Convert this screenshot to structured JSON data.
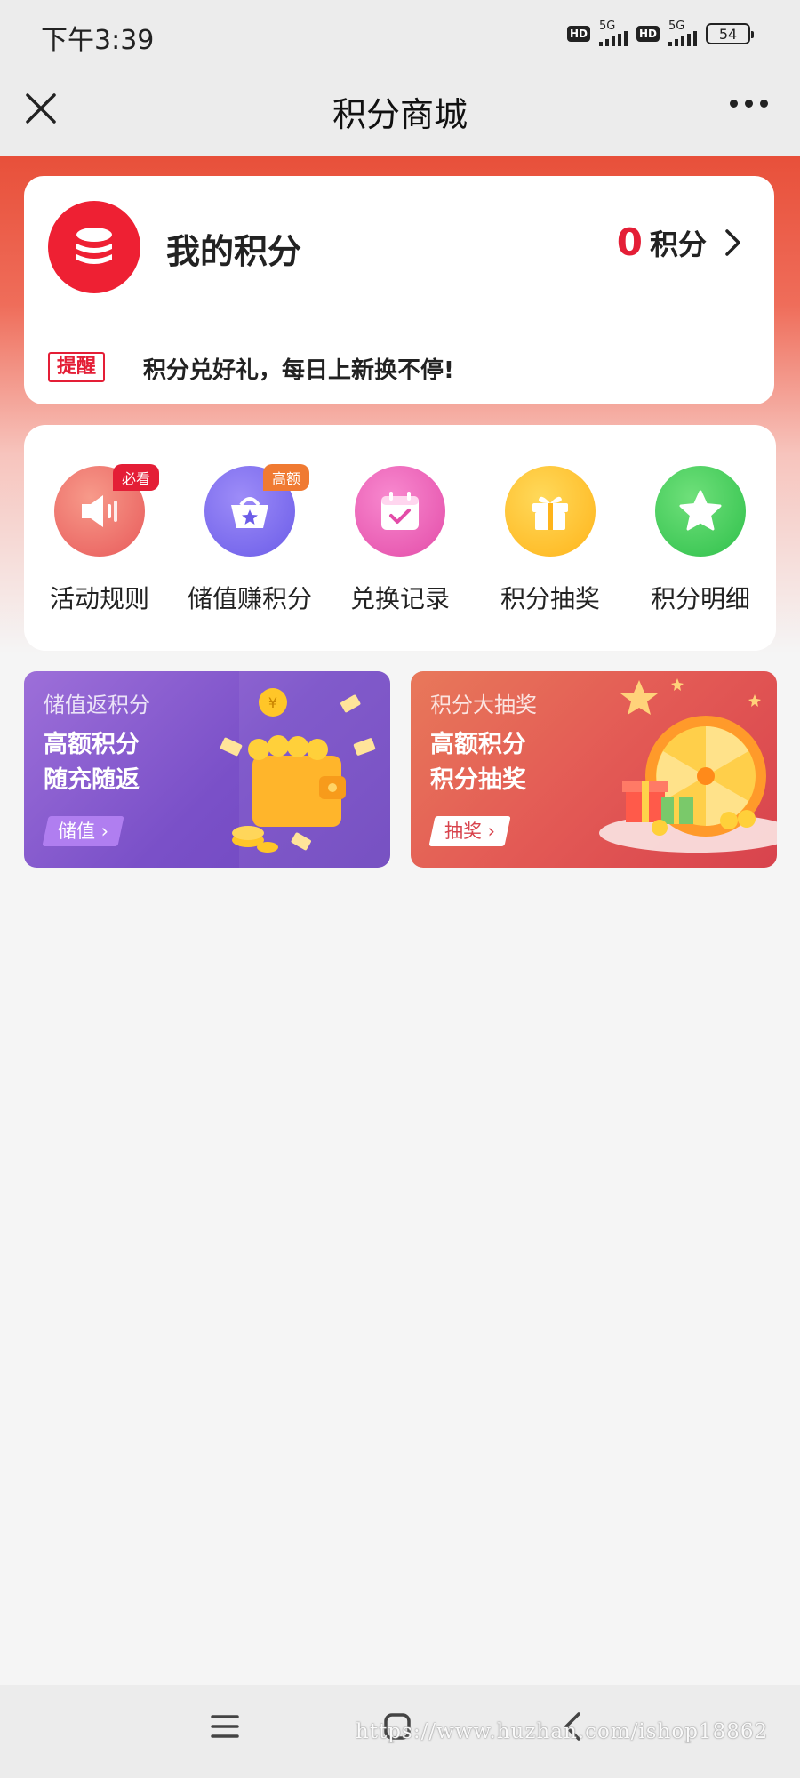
{
  "status_bar": {
    "time": "下午3:39",
    "hd1": "HD",
    "net1": "5G",
    "hd2": "HD",
    "net2": "5G",
    "battery": "54"
  },
  "nav": {
    "title": "积分商城",
    "close_icon": "close-icon",
    "more_icon": "more-icon"
  },
  "points": {
    "title": "我的积分",
    "value": "0",
    "unit": "积分",
    "reminder_tag": "提醒",
    "reminder_text": "积分兑好礼，每日上新换不停!"
  },
  "actions": [
    {
      "label": "活动规则",
      "badge": "必看",
      "icon": "speaker-icon",
      "color": "#ee6a6a",
      "badge_color": "#e41e36"
    },
    {
      "label": "储值赚积分",
      "badge": "高额",
      "icon": "basket-icon",
      "color": "#7b6cf0",
      "badge_color": "#f07a32"
    },
    {
      "label": "兑换记录",
      "badge": "",
      "icon": "calendar-icon",
      "color": "#ee5fb8"
    },
    {
      "label": "积分抽奖",
      "badge": "",
      "icon": "gift-icon",
      "color": "#ffbf1f"
    },
    {
      "label": "积分明细",
      "badge": "",
      "icon": "star-icon",
      "color": "#3ac95a"
    }
  ],
  "banners": [
    {
      "subtitle": "储值返积分",
      "line1": "高额积分",
      "line2": "随充随返",
      "button": "储值 ›"
    },
    {
      "subtitle": "积分大抽奖",
      "line1": "高额积分",
      "line2": "积分抽奖",
      "button": "抽奖 ›"
    }
  ],
  "system_nav": {
    "menu_icon": "menu-icon",
    "home_icon": "home-icon",
    "back_icon": "back-icon"
  },
  "watermark": "https://www.huzhan.com/ishop18862"
}
